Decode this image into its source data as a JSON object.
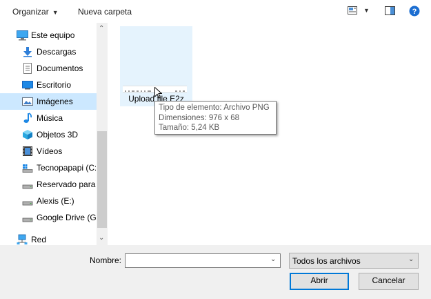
{
  "toolbar": {
    "organize_label": "Organizar",
    "new_folder_label": "Nueva carpeta"
  },
  "navigation": {
    "items": [
      {
        "label": "Este equipo",
        "icon": "computer-icon"
      },
      {
        "label": "Descargas",
        "icon": "downloads-icon"
      },
      {
        "label": "Documentos",
        "icon": "documents-icon"
      },
      {
        "label": "Escritorio",
        "icon": "desktop-icon"
      },
      {
        "label": "Imágenes",
        "icon": "pictures-icon",
        "selected": true
      },
      {
        "label": "Música",
        "icon": "music-icon"
      },
      {
        "label": "Objetos 3D",
        "icon": "3d-objects-icon"
      },
      {
        "label": "Vídeos",
        "icon": "videos-icon"
      },
      {
        "label": "Tecnopapapi (C:",
        "icon": "windows-drive-icon"
      },
      {
        "label": "Reservado para e",
        "icon": "drive-icon"
      },
      {
        "label": "Alexis (E:)",
        "icon": "drive-icon"
      },
      {
        "label": "Google Drive (G:",
        "icon": "drive-icon"
      },
      {
        "label": "Red",
        "icon": "network-icon"
      }
    ]
  },
  "content": {
    "file": {
      "name": "Upload file E2z"
    },
    "tooltip": {
      "type": "Tipo de elemento: Archivo PNG",
      "dimensions": "Dimensiones: 976 x 68",
      "size": "Tamaño: 5,24 KB"
    }
  },
  "bottom": {
    "filename_label": "Nombre:",
    "filename_value": "",
    "filter_value": "Todos los archivos",
    "open_label": "Abrir",
    "cancel_label": "Cancelar"
  },
  "colors": {
    "selection": "#cce8ff",
    "hover_tile": "#e5f3fd",
    "help_blue": "#1c6ed1",
    "default_button_border": "#0078d7"
  }
}
